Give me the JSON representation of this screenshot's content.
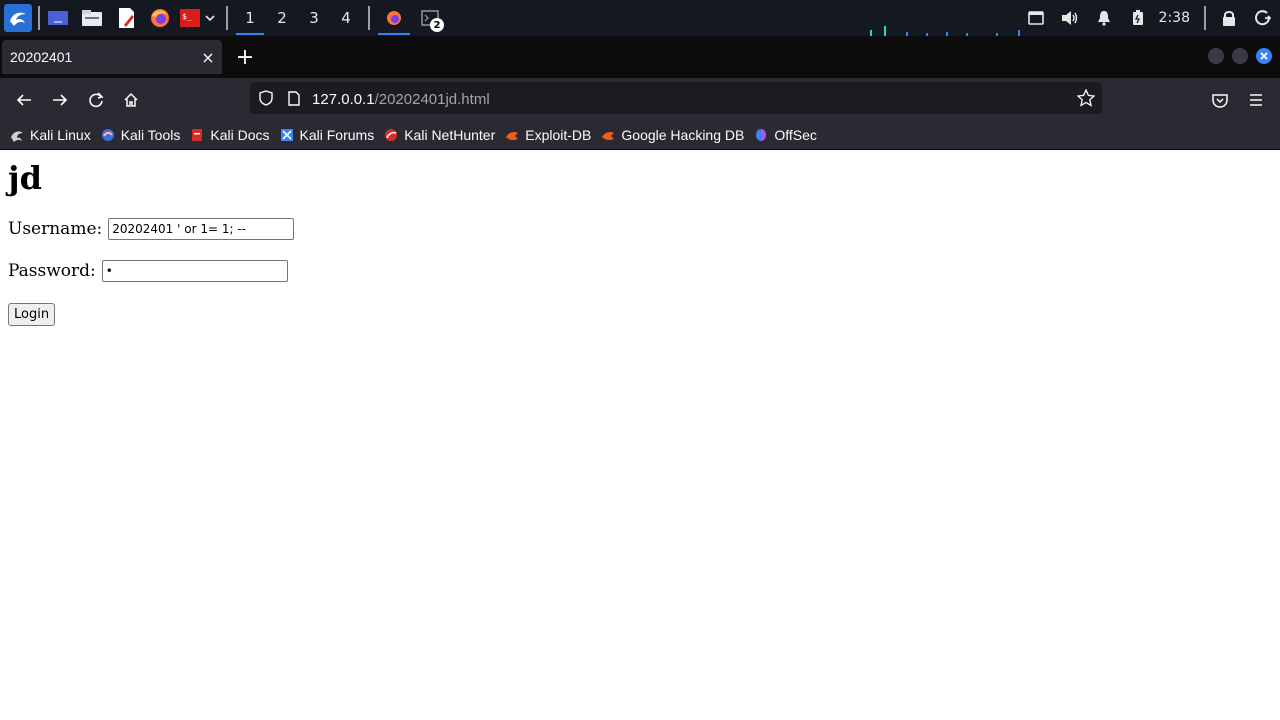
{
  "panel": {
    "workspaces": [
      "1",
      "2",
      "3",
      "4"
    ],
    "active_workspace": "1",
    "terminal_badge": "2",
    "clock": "2:38"
  },
  "browser": {
    "tab_title": "20202401",
    "tab_close": "×",
    "new_tab": "+",
    "url_host": "127.0.0.1",
    "url_path": "/20202401jd.html"
  },
  "bookmarks": [
    {
      "label": "Kali Linux",
      "icon": "kali-dragon-icon"
    },
    {
      "label": "Kali Tools",
      "icon": "kali-tools-icon"
    },
    {
      "label": "Kali Docs",
      "icon": "kali-docs-icon"
    },
    {
      "label": "Kali Forums",
      "icon": "kali-forums-icon"
    },
    {
      "label": "Kali NetHunter",
      "icon": "nethunter-icon"
    },
    {
      "label": "Exploit-DB",
      "icon": "exploit-db-icon"
    },
    {
      "label": "Google Hacking DB",
      "icon": "ghdb-icon"
    },
    {
      "label": "OffSec",
      "icon": "offsec-icon"
    }
  ],
  "page": {
    "heading": "jd",
    "username_label": "Username:",
    "username_value": "20202401 ' or 1= 1; --",
    "password_label": "Password:",
    "password_value": "•",
    "login_label": "Login"
  },
  "colors": {
    "panel_bg": "#141820",
    "browser_chrome": "#2b2a33",
    "accent": "#3b82f6"
  }
}
